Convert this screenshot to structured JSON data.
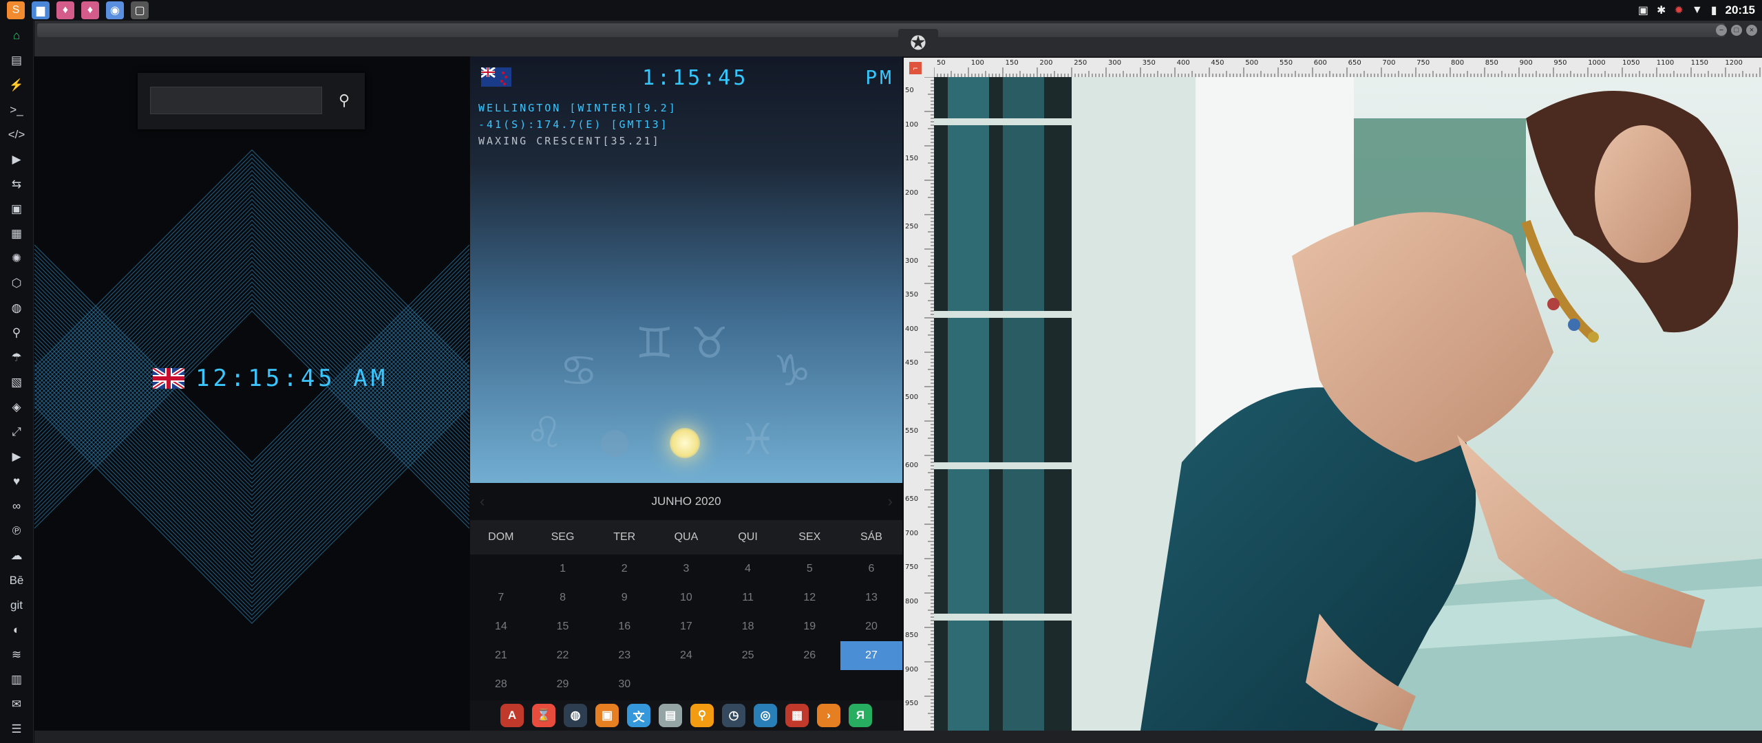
{
  "taskbar": {
    "apps": [
      {
        "name": "sublime",
        "color": "#f28b30",
        "glyph": "S"
      },
      {
        "name": "files",
        "color": "#4a87d8",
        "glyph": "▆"
      },
      {
        "name": "app-pink-1",
        "color": "#d45c8a",
        "glyph": "♦"
      },
      {
        "name": "app-pink-2",
        "color": "#d45c8a",
        "glyph": "♦"
      },
      {
        "name": "chrome",
        "color": "#5a8fe0",
        "glyph": "◉"
      },
      {
        "name": "window",
        "color": "#555",
        "glyph": "▢"
      }
    ],
    "clock": "20:15"
  },
  "sidebar": {
    "icons": [
      "home-icon",
      "document-icon",
      "bolt-icon",
      "terminal-icon",
      "code-icon",
      "play-icon",
      "translate-icon",
      "image-icon",
      "news-icon",
      "react-icon",
      "hexagon-icon",
      "globe-icon",
      "search-icon",
      "umbrella-icon",
      "contact-icon",
      "diamond-icon",
      "expand-icon",
      "youtube-icon",
      "heart-icon",
      "infinity-icon",
      "pinterest-icon",
      "cloud-icon",
      "behance-icon",
      "git-icon",
      "github-icon",
      "layers-icon",
      "map-icon",
      "mail-icon",
      "server-icon"
    ],
    "glyphs": [
      "⌂",
      "▤",
      "⚡",
      ">_",
      "</>",
      "▶",
      "⇆",
      "▣",
      "▦",
      "✺",
      "⬡",
      "◍",
      "⚲",
      "☂",
      "▧",
      "◈",
      "⤢",
      "▶",
      "♥",
      "∞",
      "℗",
      "☁",
      "Bē",
      "git",
      "◐",
      "≋",
      "▥",
      "✉",
      "☰"
    ],
    "active_color": "#2ecc71"
  },
  "left_panel": {
    "search": {
      "placeholder": "",
      "value": ""
    },
    "uk_clock": {
      "time": "12:15:45 AM"
    }
  },
  "nz_widget": {
    "time": "1:15:45",
    "ampm": "PM",
    "line1": "WELLINGTON [WINTER][9.2]",
    "line2": "-41(S):174.7(E) [GMT13]",
    "line3": "WAXING CRESCENT[35.21]"
  },
  "calendar": {
    "month": "JUNHO 2020",
    "prev": "‹",
    "next": "›",
    "weekdays": [
      "DOM",
      "SEG",
      "TER",
      "QUA",
      "QUI",
      "SEX",
      "SÁB"
    ],
    "weeks": [
      [
        "",
        "1",
        "2",
        "3",
        "4",
        "5",
        "6"
      ],
      [
        "7",
        "8",
        "9",
        "10",
        "11",
        "12",
        "13"
      ],
      [
        "14",
        "15",
        "16",
        "17",
        "18",
        "19",
        "20"
      ],
      [
        "21",
        "22",
        "23",
        "24",
        "25",
        "26",
        "27"
      ],
      [
        "28",
        "29",
        "30",
        "",
        "",
        "",
        ""
      ]
    ],
    "today": "27",
    "today_color": "#4a8fd6"
  },
  "dock": {
    "icons": [
      {
        "name": "app-a",
        "color": "#c0392b",
        "glyph": "A"
      },
      {
        "name": "hourglass",
        "color": "#e74c3c",
        "glyph": "⌛"
      },
      {
        "name": "earth",
        "color": "#2c3e50",
        "glyph": "◍"
      },
      {
        "name": "image-viewer",
        "color": "#e67e22",
        "glyph": "▣"
      },
      {
        "name": "translator",
        "color": "#3498db",
        "glyph": "文"
      },
      {
        "name": "news",
        "color": "#95a5a6",
        "glyph": "▤"
      },
      {
        "name": "search",
        "color": "#f39c12",
        "glyph": "⚲"
      },
      {
        "name": "clock",
        "color": "#34495e",
        "glyph": "◷"
      },
      {
        "name": "browser",
        "color": "#2980b9",
        "glyph": "◎"
      },
      {
        "name": "calendar",
        "color": "#c0392b",
        "glyph": "▦"
      },
      {
        "name": "terminal",
        "color": "#e67e22",
        "glyph": "›"
      },
      {
        "name": "yandex",
        "color": "#27ae60",
        "glyph": "Я"
      }
    ]
  },
  "editor": {
    "h_ticks": [
      "50",
      "100",
      "150",
      "200",
      "250",
      "300",
      "350",
      "400",
      "450",
      "500",
      "550",
      "600",
      "650",
      "700",
      "750",
      "800",
      "850",
      "900",
      "950",
      "1000",
      "1050",
      "1100",
      "1150",
      "1200"
    ],
    "v_ticks": [
      "50",
      "100",
      "150",
      "200",
      "250",
      "300",
      "350",
      "400",
      "450",
      "500",
      "550",
      "600",
      "650",
      "700",
      "750",
      "800",
      "850",
      "900",
      "950"
    ]
  }
}
